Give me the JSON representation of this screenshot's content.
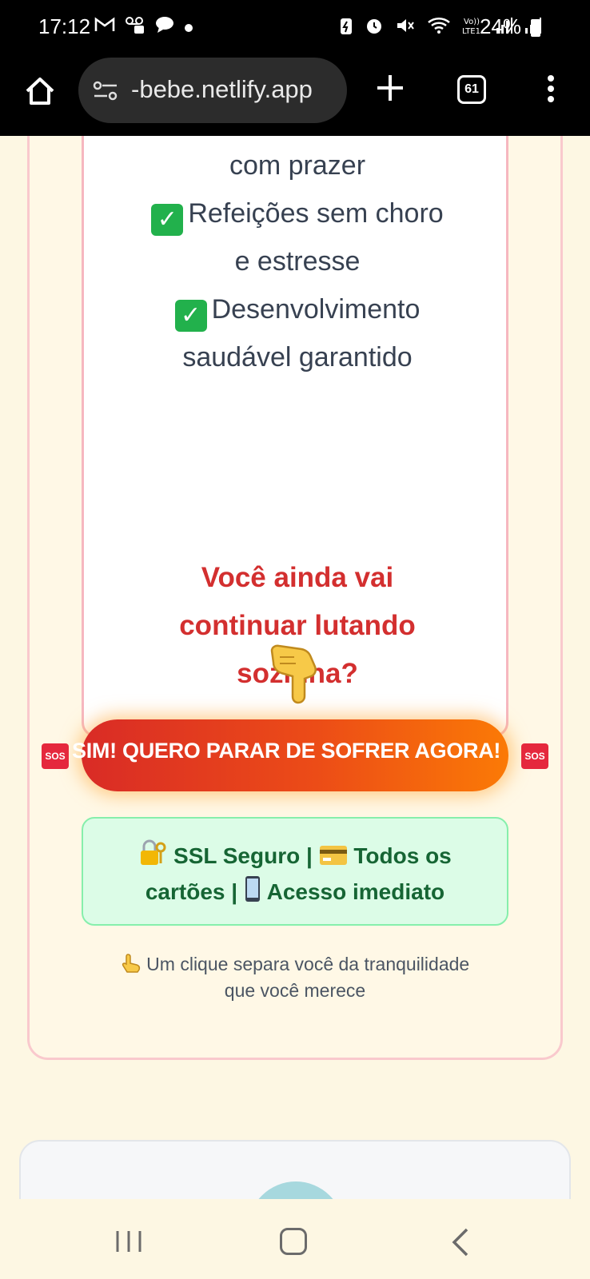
{
  "status_bar": {
    "time": "17:12",
    "battery": "24%",
    "notification_icons": [
      "gmail-icon",
      "voicemail-icon",
      "chat-bubble-icon",
      "dot-icon"
    ],
    "system_icons": [
      "battery-saver-icon",
      "alarm-icon",
      "mute-icon",
      "wifi-icon",
      "volte-icon",
      "signal-icon",
      "signal-icon"
    ]
  },
  "browser": {
    "url": "-bebe.netlify.app",
    "tab_count": "61"
  },
  "benefits": {
    "line_partial": "com prazer",
    "item_1_a": "Refeições sem choro",
    "item_1_b": "e estresse",
    "item_2_a": "Desenvolvimento",
    "item_2_b": "saudável garantido",
    "check_icon": "✓"
  },
  "question": {
    "line_1": "Você ainda vai",
    "line_2": "continuar lutando",
    "line_3": "sozinha?"
  },
  "pointer_icon": "pointing-down-hand-icon",
  "cta": {
    "label": "SIM! QUERO PARAR DE SOFRER AGORA!",
    "sos": "SOS"
  },
  "secure": {
    "ssl": "SSL Seguro |",
    "cards": "Todos os",
    "cards_2": "cartões |",
    "access": "Acesso imediato"
  },
  "hint": {
    "line_1": "Um clique separa você da tranquilidade",
    "line_2": "que você merece"
  },
  "colors": {
    "cta_start": "#d92b26",
    "cta_end": "#fb7a06",
    "question": "#d32f2f",
    "secure_text": "#166534",
    "secure_bg": "#dcfce7"
  }
}
